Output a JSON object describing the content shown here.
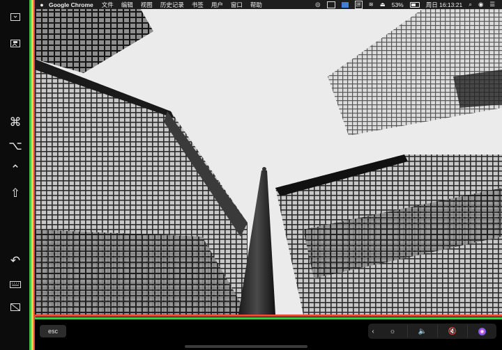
{
  "menubar": {
    "app_name": "Google Chrome",
    "menus": [
      "文件",
      "编辑",
      "视图",
      "历史记录",
      "书签",
      "用户",
      "窗口",
      "帮助"
    ],
    "battery_percent": "53%",
    "clock": "周日 16:13:21",
    "input_method": "拼"
  },
  "sidebar": {
    "icons": [
      "screen-icon",
      "desktop-icon",
      "command-key-icon",
      "option-key-icon",
      "control-key-icon",
      "shift-key-icon",
      "undo-icon",
      "keyboard-icon",
      "hide-screen-icon"
    ]
  },
  "touchbar": {
    "esc_label": "esc",
    "control_strip": [
      "collapse-chevron-icon",
      "brightness-icon",
      "volume-icon",
      "mute-icon",
      "siri-icon"
    ]
  },
  "colors": {
    "frame_red": "#e5493a",
    "frame_yellow": "#f2d33b",
    "frame_green": "#41c451",
    "menubar_bg": "#1e1e1e",
    "sky": "#e9e9e9"
  }
}
